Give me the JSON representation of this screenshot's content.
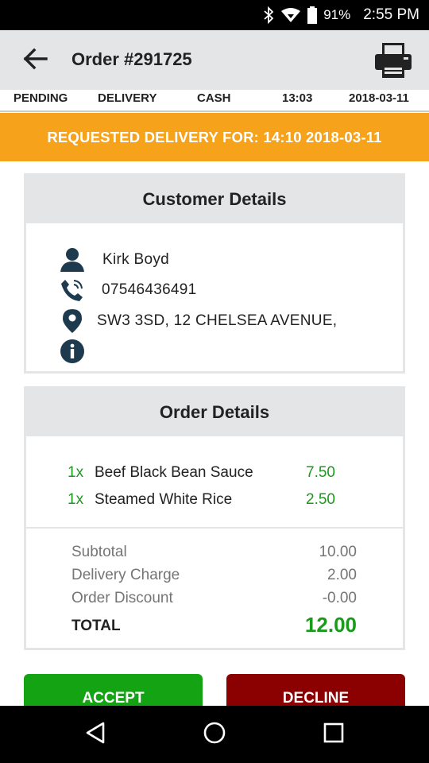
{
  "status_bar": {
    "battery": "91%",
    "time": "2:55 PM",
    "icons": [
      "bluetooth-icon",
      "wifi-icon",
      "battery-icon"
    ]
  },
  "app_bar": {
    "title": "Order #291725",
    "back_icon": "arrow-left-icon",
    "print_icon": "printer-icon"
  },
  "meta": {
    "status": "PENDING",
    "type": "DELIVERY",
    "payment": "CASH",
    "time": "13:03",
    "date": "2018-03-11"
  },
  "banner": {
    "text": "REQUESTED DELIVERY FOR: 14:10 2018-03-11"
  },
  "customer": {
    "title": "Customer Details",
    "name": "Kirk Boyd",
    "phone": "07546436491",
    "address": "SW3 3SD, 12 CHELSEA AVENUE,",
    "info": ""
  },
  "order": {
    "title": "Order Details",
    "items": [
      {
        "qty": "1x",
        "name": "Beef Black Bean Sauce",
        "price": "7.50"
      },
      {
        "qty": "1x",
        "name": "Steamed White Rice",
        "price": "2.50"
      }
    ],
    "subtotal_label": "Subtotal",
    "subtotal": "10.00",
    "delivery_label": "Delivery Charge",
    "delivery": "2.00",
    "discount_label": "Order Discount",
    "discount": "-0.00",
    "total_label": "TOTAL",
    "total": "12.00"
  },
  "actions": {
    "accept": "ACCEPT",
    "decline": "DECLINE"
  },
  "colors": {
    "banner": "#f7a21b",
    "accept": "#13a313",
    "decline": "#8b0000",
    "price_green": "#1a9a1a",
    "header_gray": "#e3e5e6",
    "icon_navy": "#1e3a4f"
  },
  "nav_bar": {
    "icons": [
      "back-triangle-icon",
      "home-circle-icon",
      "recents-square-icon"
    ]
  }
}
